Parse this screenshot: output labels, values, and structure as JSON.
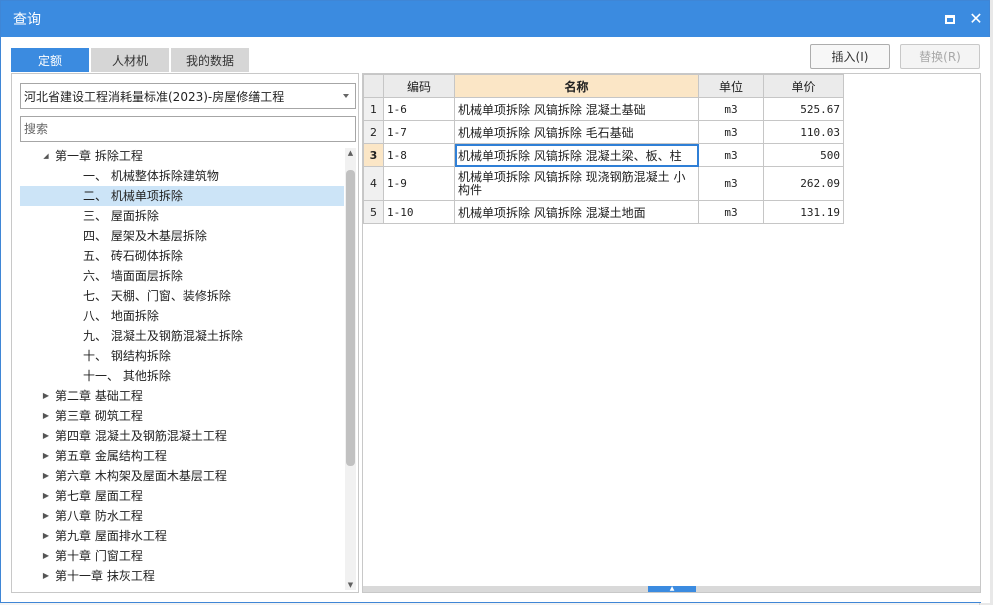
{
  "window": {
    "title": "查询"
  },
  "tabs": [
    {
      "label": "定额",
      "active": true
    },
    {
      "label": "人材机",
      "active": false
    },
    {
      "label": "我的数据",
      "active": false
    }
  ],
  "actions": {
    "insert_label": "插入(I)",
    "replace_label": "替换(R)"
  },
  "left": {
    "standard_select": "河北省建设工程消耗量标准(2023)-房屋修缮工程",
    "search_placeholder": "搜索",
    "tree": [
      {
        "label": "第一章 拆除工程",
        "level": 0,
        "expanded": true
      },
      {
        "label": "一、 机械整体拆除建筑物",
        "level": 1
      },
      {
        "label": "二、 机械单项拆除",
        "level": 1,
        "selected": true
      },
      {
        "label": "三、 屋面拆除",
        "level": 1
      },
      {
        "label": "四、 屋架及木基层拆除",
        "level": 1
      },
      {
        "label": "五、 砖石砌体拆除",
        "level": 1
      },
      {
        "label": "六、 墙面面层拆除",
        "level": 1
      },
      {
        "label": "七、 天棚、门窗、装修拆除",
        "level": 1
      },
      {
        "label": "八、 地面拆除",
        "level": 1
      },
      {
        "label": "九、 混凝土及钢筋混凝土拆除",
        "level": 1
      },
      {
        "label": "十、 钢结构拆除",
        "level": 1
      },
      {
        "label": "十一、 其他拆除",
        "level": 1
      },
      {
        "label": "第二章 基础工程",
        "level": 0
      },
      {
        "label": "第三章 砌筑工程",
        "level": 0
      },
      {
        "label": "第四章 混凝土及钢筋混凝土工程",
        "level": 0
      },
      {
        "label": "第五章 金属结构工程",
        "level": 0
      },
      {
        "label": "第六章 木构架及屋面木基层工程",
        "level": 0
      },
      {
        "label": "第七章 屋面工程",
        "level": 0
      },
      {
        "label": "第八章 防水工程",
        "level": 0
      },
      {
        "label": "第九章 屋面排水工程",
        "level": 0
      },
      {
        "label": "第十章 门窗工程",
        "level": 0
      },
      {
        "label": "第十一章 抹灰工程",
        "level": 0
      }
    ]
  },
  "grid": {
    "headers": {
      "code": "编码",
      "name": "名称",
      "unit": "单位",
      "price": "单价"
    },
    "rows": [
      {
        "num": "1",
        "code": "1-6",
        "name": "机械单项拆除 风镐拆除 混凝土基础",
        "unit": "m3",
        "price": "525.67"
      },
      {
        "num": "2",
        "code": "1-7",
        "name": "机械单项拆除 风镐拆除 毛石基础",
        "unit": "m3",
        "price": "110.03"
      },
      {
        "num": "3",
        "code": "1-8",
        "name": "机械单项拆除 风镐拆除 混凝土梁、板、柱",
        "unit": "m3",
        "price": "500",
        "current": true
      },
      {
        "num": "4",
        "code": "1-9",
        "name": "机械单项拆除 风镐拆除 现浇钢筋混凝土 小构件",
        "unit": "m3",
        "price": "262.09"
      },
      {
        "num": "5",
        "code": "1-10",
        "name": "机械单项拆除 风镐拆除 混凝土地面",
        "unit": "m3",
        "price": "131.19"
      }
    ]
  },
  "icons": {
    "maximize": "maximize-icon",
    "close": "close-icon",
    "expanded": "expand-arrow-icon",
    "collapsed": "collapse-arrow-icon"
  }
}
